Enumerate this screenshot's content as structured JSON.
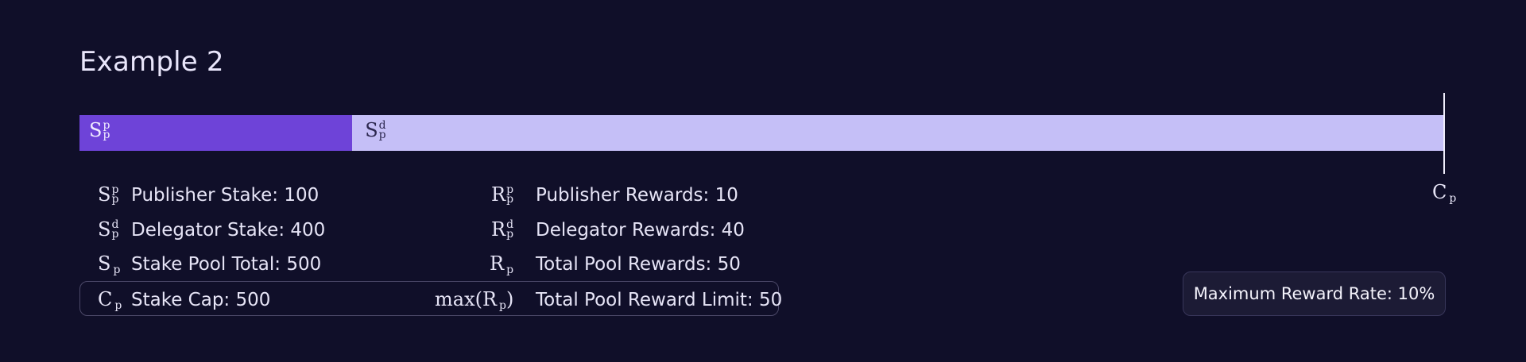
{
  "title": "Example 2",
  "colors": {
    "background": "#100f29",
    "publisher_segment": "#6e43d8",
    "delegator_segment": "#c5bff7"
  },
  "bar": {
    "stake_cap": 500,
    "publisher_stake": 100,
    "delegator_stake": 400,
    "publisher_symbol": {
      "base": "S",
      "sup": "p",
      "sub": "p"
    },
    "delegator_symbol": {
      "base": "S",
      "sup": "d",
      "sub": "p"
    },
    "cap_symbol": {
      "base": "C",
      "sub": "p"
    }
  },
  "legend": {
    "stakes": [
      {
        "base": "S",
        "sup": "p",
        "sub": "p",
        "text": "Publisher Stake: 100"
      },
      {
        "base": "S",
        "sup": "d",
        "sub": "p",
        "text": "Delegator Stake: 400"
      },
      {
        "base": "S",
        "sup": "",
        "sub": "p",
        "text": "Stake Pool Total: 500"
      },
      {
        "base": "C",
        "sup": "",
        "sub": "p",
        "text": "Stake Cap: 500"
      }
    ],
    "rewards": [
      {
        "base": "R",
        "sup": "p",
        "sub": "p",
        "text": "Publisher Rewards: 10"
      },
      {
        "base": "R",
        "sup": "d",
        "sub": "p",
        "text": "Delegator Rewards: 40"
      },
      {
        "base": "R",
        "sup": "",
        "sub": "p",
        "text": "Total Pool Rewards: 50"
      },
      {
        "base": "max(R",
        "sup": "",
        "sub": "p",
        "close": ")",
        "text": "Total Pool Reward Limit: 50"
      }
    ]
  },
  "max_reward_rate": "Maximum Reward Rate: 10%"
}
